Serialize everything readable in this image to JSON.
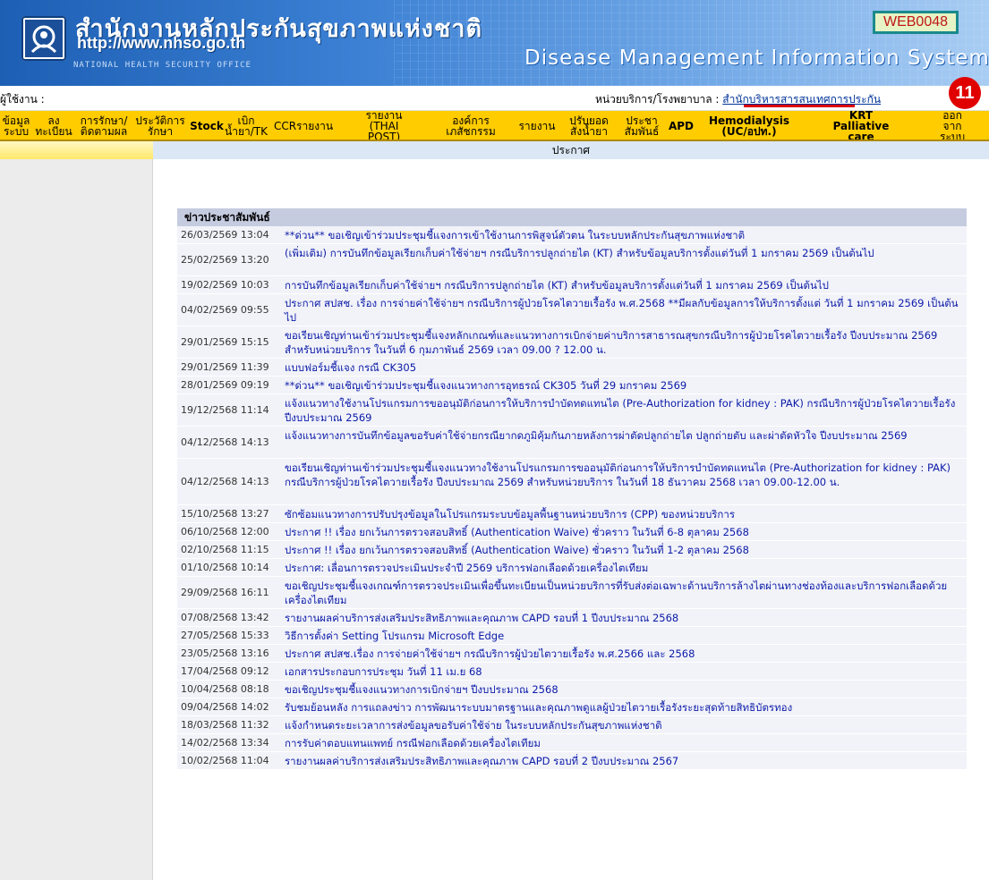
{
  "header": {
    "org_thai": "สำนักงานหลักประกันสุขภาพแห่งชาติ",
    "org_url": "http://www.nhso.go.th",
    "org_english": "NATIONAL HEALTH SECURITY OFFICE",
    "system_title": "Disease Management Information System",
    "page_code": "WEB0048"
  },
  "userbar": {
    "user_label": "ผู้ใช้งาน :",
    "unit_label": "หน่วยบริการ/โรงพยาบาล :",
    "unit_name": "สำนักบริหารสารสนเทศการประกัน",
    "badge_number": "11"
  },
  "menu": [
    {
      "line1": "ข้อมูล",
      "line2": "ระบบ"
    },
    {
      "line1": "ลง",
      "line2": "ทะเบียน"
    },
    {
      "line1": "การรักษา/",
      "line2": "ติดตามผล"
    },
    {
      "line1": "ประวัติการ",
      "line2": "รักษา"
    },
    {
      "line1": "Stock",
      "line2": ""
    },
    {
      "line1": "เบิก",
      "line2": "น้ำยา/TK"
    },
    {
      "line1": "CCRรายงาน",
      "line2": ""
    },
    {
      "line1": "รายงาน",
      "line2": "(THAI",
      "line3": "POST)"
    },
    {
      "line1": "องค์การ",
      "line2": "เภสัชกรรม"
    },
    {
      "line1": "รายงาน",
      "line2": ""
    },
    {
      "line1": "ปรับยอด",
      "line2": "สั่งน้ำยา"
    },
    {
      "line1": "ประชา",
      "line2": "สัมพันธ์"
    },
    {
      "line1": "APD",
      "line2": ""
    },
    {
      "line1": "Hemodialysis",
      "line2": "(UC/อปท.)"
    },
    {
      "line1": "KRT",
      "line2": "Palliative",
      "line3": "care"
    },
    {
      "line1": "ออก",
      "line2": "จาก",
      "line3": "ระบบ"
    }
  ],
  "notice_header": "ประกาศ",
  "news_title": "ข่าวประชาสัมพันธ์",
  "news": [
    {
      "date": "26/03/2569 13:04",
      "text": "**ด่วน** ขอเชิญเข้าร่วมประชุมชี้แจงการเข้าใช้งานการพิสูจน์ตัวตน ในระบบหลักประกันสุขภาพแห่งชาติ"
    },
    {
      "date": "25/02/2569 13:20",
      "text": "(เพิ่มเติม) การบันทึกข้อมูลเรียกเก็บค่าใช้จ่ายฯ กรณีบริการปลูกถ่ายไต (KT) สำหรับข้อมูลบริการตั้งแต่วันที่ 1 มกราคม 2569 เป็นต้นไป"
    },
    {
      "date": "19/02/2569 10:03",
      "text": "การบันทึกข้อมูลเรียกเก็บค่าใช้จ่ายฯ กรณีบริการปลูกถ่ายไต (KT) สำหรับข้อมูลบริการตั้งแต่วันที่ 1 มกราคม 2569 เป็นต้นไป"
    },
    {
      "date": "04/02/2569 09:55",
      "text": "ประกาศ สปสช. เรื่อง การจ่ายค่าใช้จ่ายฯ กรณีบริการผู้ป่วยโรคไตวายเรื้อรัง พ.ศ.2568 **มีผลกับข้อมูลการให้บริการตั้งแต่ วันที่ 1 มกราคม 2569 เป็นต้นไป"
    },
    {
      "date": "29/01/2569 15:15",
      "text": "ขอเรียนเชิญท่านเข้าร่วมประชุมชี้แจงหลักเกณฑ์และแนวทางการเบิกจ่ายค่าบริการสาธารณสุขกรณีบริการผู้ป่วยโรคไตวายเรื้อรัง ปีงบประมาณ 2569 สำหรับหน่วยบริการ ในวันที่ 6 กุมภาพันธ์ 2569 เวลา 09.00 ? 12.00 น."
    },
    {
      "date": "29/01/2569 11:39",
      "text": "แบบฟอร์มชี้แจง กรณี CK305"
    },
    {
      "date": "28/01/2569 09:19",
      "text": "**ด่วน** ขอเชิญเข้าร่วมประชุมชี้แจงแนวทางการอุทธรณ์ CK305 วันที่ 29 มกราคม 2569"
    },
    {
      "date": "19/12/2568 11:14",
      "text": "แจ้งแนวทางใช้งานโปรแกรมการขออนุมัติก่อนการให้บริการบำบัดทดแทนไต (Pre-Authorization for kidney : PAK) กรณีบริการผู้ป่วยโรคไตวายเรื้อรัง ปีงบประมาณ 2569"
    },
    {
      "date": "04/12/2568 14:13",
      "text": "แจ้งแนวทางการบันทึกข้อมูลขอรับค่าใช้จ่ายกรณียากดภูมิคุ้มกันภายหลังการผ่าตัดปลูกถ่ายไต ปลูกถ่ายตับ และผ่าตัดหัวใจ ปีงบประมาณ 2569"
    },
    {
      "date": "04/12/2568 14:13",
      "text": "ขอเรียนเชิญท่านเข้าร่วมประชุมชี้แจงแนวทางใช้งานโปรแกรมการขออนุมัติก่อนการให้บริการบำบัดทดแทนไต (Pre-Authorization for kidney : PAK) กรณีบริการผู้ป่วยโรคไตวายเรื้อรัง ปีงบประมาณ 2569 สำหรับหน่วยบริการ ในวันที่ 18 ธันวาคม 2568 เวลา 09.00-12.00 น."
    },
    {
      "date": "15/10/2568 13:27",
      "text": "ซักซ้อมแนวทางการปรับปรุงข้อมูลในโปรแกรมระบบข้อมูลพื้นฐานหน่วยบริการ (CPP) ของหน่วยบริการ"
    },
    {
      "date": "06/10/2568 12:00",
      "text": "ประกาศ !! เรื่อง ยกเว้นการตรวจสอบสิทธิ์ (Authentication Waive) ชั่วคราว ในวันที่ 6-8 ตุลาคม 2568"
    },
    {
      "date": "02/10/2568 11:15",
      "text": "ประกาศ !! เรื่อง ยกเว้นการตรวจสอบสิทธิ์ (Authentication Waive) ชั่วคราว ในวันที่ 1-2 ตุลาคม 2568"
    },
    {
      "date": "01/10/2568 10:14",
      "text": "ประกาศ: เลื่อนการตรวจประเมินประจำปี 2569 บริการฟอกเลือดด้วยเครื่องไตเทียม"
    },
    {
      "date": "29/09/2568 16:11",
      "text": "ขอเชิญประชุมชี้แจงเกณฑ์การตรวจประเมินเพื่อขึ้นทะเบียนเป็นหน่วยบริการที่รับส่งต่อเฉพาะด้านบริการล้างไตผ่านทางช่องท้องและบริการฟอกเลือดด้วยเครื่องไตเทียม"
    },
    {
      "date": "07/08/2568 13:42",
      "text": "รายงานผลค่าบริการส่งเสริมประสิทธิภาพและคุณภาพ CAPD รอบที่ 1 ปีงบประมาณ 2568"
    },
    {
      "date": "27/05/2568 15:33",
      "text": "วิธีการตั้งค่า Setting โปรแกรม Microsoft Edge"
    },
    {
      "date": "23/05/2568 13:16",
      "text": "ประกาศ สปสช.เรื่อง การจ่ายค่าใช้จ่ายฯ กรณีบริการผู้ป่วยไตวายเรื้อรัง พ.ศ.2566 และ 2568"
    },
    {
      "date": "17/04/2568 09:12",
      "text": "เอกสารประกอบการประชุม วันที่ 11 เม.ย 68"
    },
    {
      "date": "10/04/2568 08:18",
      "text": "ขอเชิญประชุมชี้แจงแนวทางการเบิกจ่ายฯ ปีงบประมาณ 2568"
    },
    {
      "date": "09/04/2568 14:02",
      "text": "รับชมย้อนหลัง การแถลงข่าว การพัฒนาระบบมาตรฐานและคุณภาพดูแลผู้ป่วยไตวายเรื้อรังระยะสุดท้ายสิทธิบัตรทอง"
    },
    {
      "date": "18/03/2568 11:32",
      "text": "แจ้งกำหนดระยะเวลาการส่งข้อมูลขอรับค่าใช้จ่าย ในระบบหลักประกันสุขภาพแห่งชาติ"
    },
    {
      "date": "14/02/2568 13:34",
      "text": "การรับค่าตอบแทนแพทย์ กรณีฟอกเลือดด้วยเครื่องไตเทียม"
    },
    {
      "date": "10/02/2568 11:04",
      "text": "รายงานผลค่าบริการส่งเสริมประสิทธิภาพและคุณภาพ CAPD รอบที่ 2 ปีงบประมาณ 2567"
    }
  ]
}
